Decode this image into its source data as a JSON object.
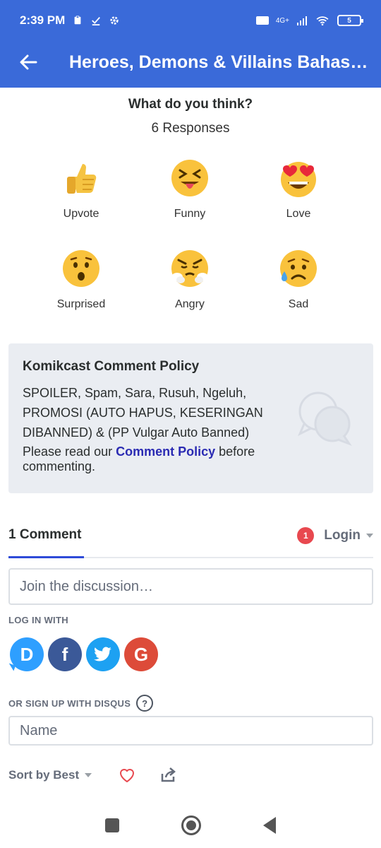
{
  "status_bar": {
    "time": "2:39 PM",
    "network": "4G+",
    "battery": "5"
  },
  "toolbar": {
    "title": "Heroes, Demons & Villains Bahasa Indonesia"
  },
  "reactions": {
    "question": "What do you think?",
    "responses": "6 Responses",
    "items": [
      {
        "label": "Upvote",
        "icon": "thumbs-up-emoji"
      },
      {
        "label": "Funny",
        "icon": "tongue-squint-emoji"
      },
      {
        "label": "Love",
        "icon": "heart-eyes-emoji"
      },
      {
        "label": "Surprised",
        "icon": "surprised-emoji"
      },
      {
        "label": "Angry",
        "icon": "angry-steam-emoji"
      },
      {
        "label": "Sad",
        "icon": "sad-sweat-emoji"
      }
    ]
  },
  "policy": {
    "title": "Komikcast Comment Policy",
    "text": "SPOILER, Spam, Sara, Rusuh, Ngeluh, PROMOSI (AUTO HAPUS, KESERINGAN DIBANNED) & (PP Vulgar Auto Banned)",
    "read_prefix": "Please read our",
    "link": "Comment Policy",
    "read_suffix": "before commenting."
  },
  "comments": {
    "count_label": "1 Comment",
    "notification_count": "1",
    "login_label": "Login",
    "discussion_placeholder": "Join the discussion…",
    "log_in_with": "LOG IN WITH",
    "sign_up_label": "OR SIGN UP WITH DISQUS",
    "help_glyph": "?",
    "name_placeholder": "Name",
    "sort_label": "Sort by Best",
    "social": {
      "disqus": "D",
      "facebook": "f",
      "google": "G"
    }
  },
  "colors": {
    "appbar": "#3a6ad9",
    "link": "#2b2bb3",
    "tab_underline": "#2e4bd8",
    "notif": "#e8484f"
  }
}
